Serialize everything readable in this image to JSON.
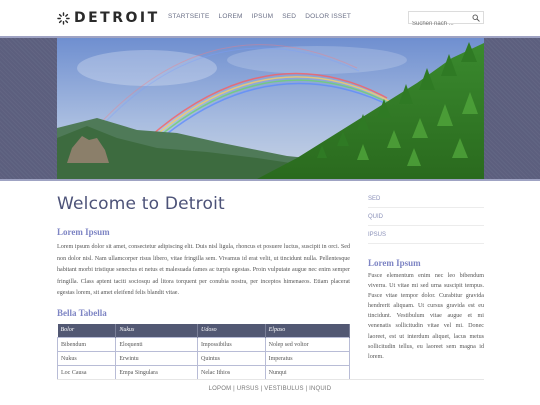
{
  "header": {
    "logo_text": "DETROIT",
    "nav": [
      "STARTSEITE",
      "LOREM",
      "IPSUM",
      "SED",
      "DOLOR ISSET"
    ],
    "search_placeholder": "Suchen nach ..."
  },
  "colors": {
    "accent": "#7e85c4",
    "title": "#4c5278",
    "band": "#5c5f7e",
    "table_header": "#525873"
  },
  "main": {
    "title": "Welcome to Detroit",
    "section1_title": "Lorem Ipsum",
    "section1_text": "Lorem ipsum dolor sit amet, consectetur adipiscing elit. Duis nisl ligula, rhoncus et posuere luctus, suscipit in orci. Sed non dolor nisl. Nam ullamcorper risus libero, vitae fringilla sem. Vivamus id erat velit, ut tincidunt nulla. Pellentesque habitant morbi tristique senectus et netus et malesuada fames ac turpis egestas. Proin vulputate augue nec enim semper fringilla. Class aptent taciti sociosqu ad litora torquent per conubia nostra, per inceptos himenaeos. Etiam placerat egestas lorem, sit amet eleifend felis blandit vitae.",
    "section2_title": "Bella Tabella",
    "table": {
      "headers": [
        "Bolor",
        "Nukus",
        "Udoso",
        "Elpaso"
      ],
      "rows": [
        [
          "Bibendum",
          "Eloquenti",
          "Impossibilus",
          "Nolep sed voltor"
        ],
        [
          "Nukus",
          "Erwintu",
          "Quintus",
          "Imperatus"
        ],
        [
          "Loc Causa",
          "Empa Singulara",
          "Nelac Ithios",
          "Nunqui"
        ]
      ]
    }
  },
  "sidebar": {
    "links": [
      "SED",
      "QUID",
      "IPSUS"
    ],
    "title": "Lorem Ipsum",
    "text": "Fusce elementum enim nec leo bibendum viverra. Ut vitae mi sed urna suscipit tempus. Fusce vitae tempor dolor. Curabitur gravida hendrerit aliquam. Ut cursus gravida est eu tincidunt. Vestibulum vitae augue et mi venenatis sollicitudin vitae vel mi. Donec laoreet, est ut interdum aliquet, lacus metus sollicitudin tellus, eu laoreet sem magna id lorem."
  },
  "footer": {
    "links_text": "LOPOM | URSUS | VESTIBULUS | INQUID"
  }
}
